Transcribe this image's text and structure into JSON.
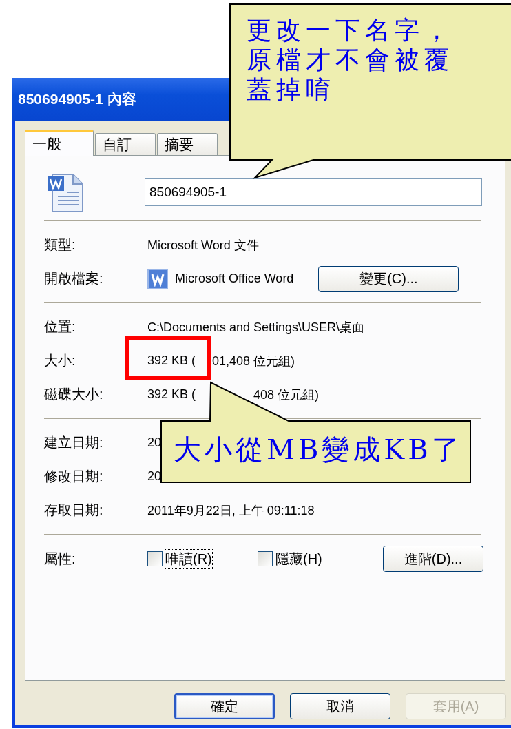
{
  "window": {
    "title": "850694905-1 內容"
  },
  "tabs": [
    {
      "label": "一般",
      "selected": true
    },
    {
      "label": "自訂",
      "selected": false
    },
    {
      "label": "摘要",
      "selected": false
    }
  ],
  "file_name": {
    "value": "850694905-1"
  },
  "sections": [
    [
      {
        "kind": "text",
        "label": "類型:",
        "value": "Microsoft Word 文件"
      },
      {
        "kind": "app",
        "label": "開啟檔案:",
        "value": "Microsoft Office Word",
        "button": "變更(C)..."
      }
    ],
    [
      {
        "kind": "text",
        "label": "位置:",
        "value": "C:\\Documents and Settings\\USER\\桌面"
      },
      {
        "kind": "split",
        "label": "大小:",
        "value": "392 KB (",
        "value_end": "01,408 位元組)"
      },
      {
        "kind": "split",
        "label": "磁碟大小:",
        "value": "392 KB (",
        "value_end": "408 位元組)"
      }
    ],
    [
      {
        "kind": "text",
        "label": "建立日期:",
        "value": "20"
      },
      {
        "kind": "text",
        "label": "修改日期:",
        "value": "20"
      },
      {
        "kind": "text",
        "label": "存取日期:",
        "value": "2011年9月22日, 上午 09:11:18"
      }
    ]
  ],
  "attributes": {
    "label": "屬性:",
    "checkboxes": [
      {
        "label": "唯讀(R)",
        "checked": false,
        "focused": true
      },
      {
        "label": "隱藏(H)",
        "checked": false,
        "focused": false
      }
    ],
    "button": "進階(D)..."
  },
  "buttons": [
    {
      "label": "確定",
      "default": true,
      "disabled": false
    },
    {
      "label": "取消",
      "default": false,
      "disabled": false
    },
    {
      "label": "套用(A)",
      "default": false,
      "disabled": true
    }
  ],
  "callouts": [
    {
      "kind": "top",
      "text": "更改一下名字，原檔才不會被覆蓋掉唷"
    },
    {
      "kind": "bottom",
      "text": "大小從MB變成KB了"
    }
  ]
}
